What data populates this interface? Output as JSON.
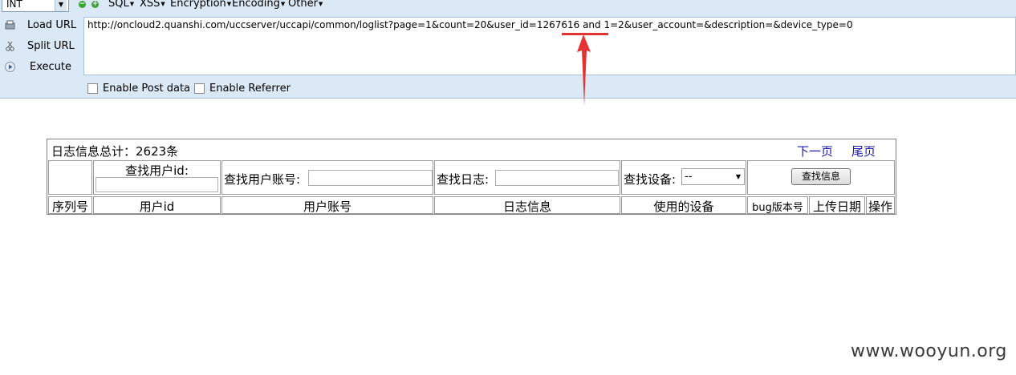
{
  "toolbar": {
    "select_value": "INT",
    "menus": [
      "SQL",
      "XSS",
      "Encryption",
      "Encoding",
      "Other"
    ],
    "load_url": "Load URL",
    "split_url": "Split URL",
    "execute": "Execute",
    "url_value": "http://oncloud2.quanshi.com/uccserver/uccapi/common/loglist?page=1&count=20&user_id=1267616 and 1=2&user_account=&description=&device_type=0",
    "enable_post": "Enable Post data",
    "enable_referrer": "Enable Referrer"
  },
  "log": {
    "title": "日志信息总计：2623条",
    "next_page": "下一页",
    "last_page": "尾页",
    "search_user_id": "查找用户id:",
    "search_account": "查找用户账号:",
    "search_log": "查找日志:",
    "search_device": "查找设备:",
    "device_value": "--",
    "search_button": "查找信息",
    "columns": [
      "序列号",
      "用户id",
      "用户账号",
      "日志信息",
      "使用的设备",
      "bug版本号",
      "上传日期",
      "操作"
    ]
  },
  "annotation_color": "#e53333",
  "watermark": "www.wooyun.org"
}
